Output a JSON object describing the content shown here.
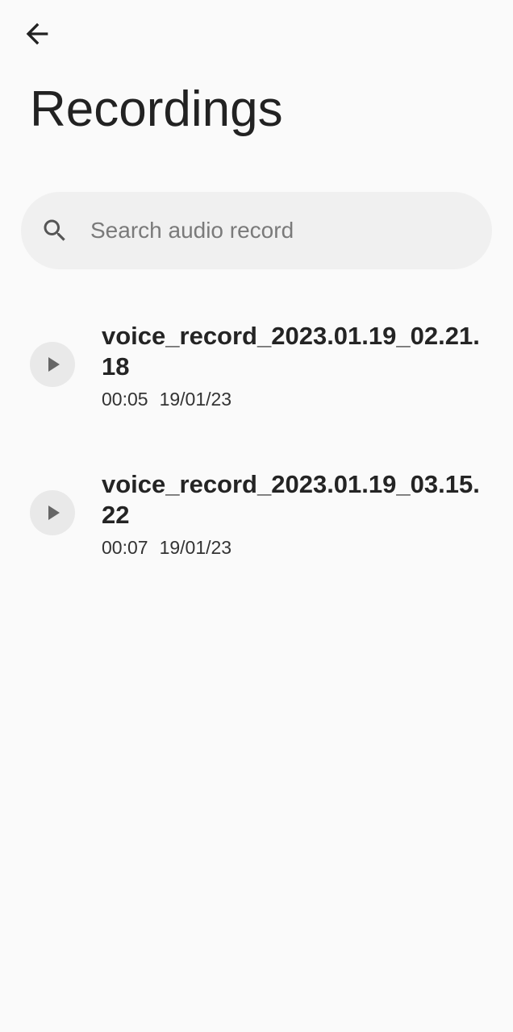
{
  "header": {
    "title": "Recordings",
    "back_icon": "arrow-back-icon"
  },
  "search": {
    "placeholder": "Search audio record",
    "value": "",
    "icon": "search-icon"
  },
  "recordings": [
    {
      "name": "voice_record_2023.01.19_02.21.18",
      "duration": "00:05",
      "date": "19/01/23",
      "icon": "play-icon"
    },
    {
      "name": "voice_record_2023.01.19_03.15.22",
      "duration": "00:07",
      "date": "19/01/23",
      "icon": "play-icon"
    }
  ],
  "colors": {
    "background": "#fafafa",
    "search_bg": "#f0f0f0",
    "play_button_bg": "#e9e9e9",
    "text_primary": "#222222",
    "placeholder": "#7a7a7a"
  }
}
